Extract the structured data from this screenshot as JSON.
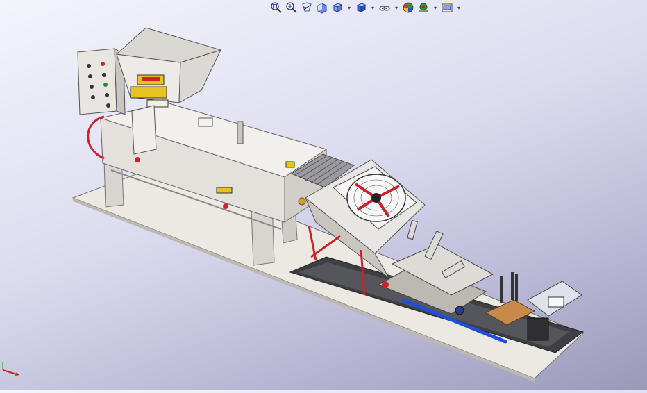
{
  "app": {
    "window_type": "cad-3d-viewport",
    "toolbar": [
      {
        "name": "zoom-to-fit-icon",
        "kind": "button"
      },
      {
        "name": "zoom-to-area-icon",
        "kind": "button"
      },
      {
        "name": "previous-view-icon",
        "kind": "button"
      },
      {
        "name": "section-view-icon",
        "kind": "button"
      },
      {
        "name": "view-orientation-icon",
        "kind": "button",
        "has_dropdown": true
      },
      {
        "name": "display-style-icon",
        "kind": "button",
        "has_dropdown": true
      },
      {
        "name": "hide-show-items-icon",
        "kind": "button",
        "has_dropdown": true
      },
      {
        "name": "edit-appearance-icon",
        "kind": "button"
      },
      {
        "name": "apply-scene-icon",
        "kind": "button",
        "has_dropdown": true
      },
      {
        "name": "view-settings-icon",
        "kind": "button",
        "has_dropdown": true
      }
    ],
    "colors": {
      "background_top": "#f4f4fb",
      "background_bottom": "#9a9ab8",
      "machine_body": "#e6e3df",
      "machine_shadow": "#b8b5b0",
      "accent_red": "#d0202a",
      "accent_blue": "#1f4fd8",
      "base_plate": "#3a3a3e",
      "triad_x": "#d01818"
    }
  }
}
